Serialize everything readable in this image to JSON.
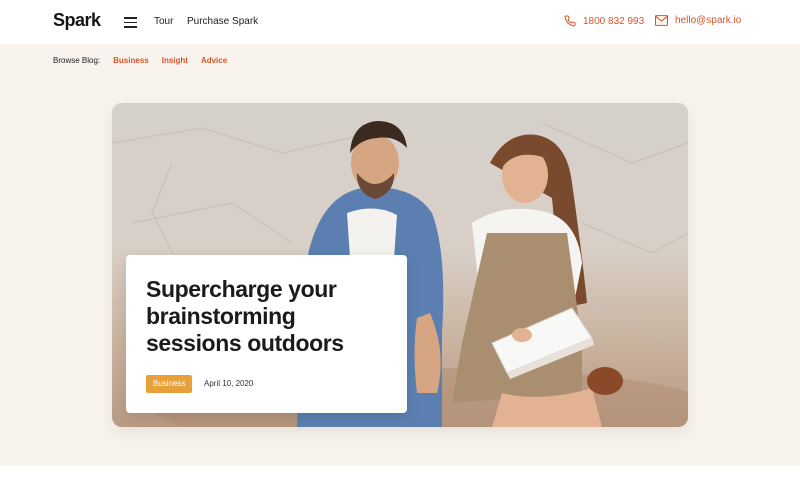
{
  "header": {
    "logo": "Spark",
    "nav": [
      {
        "label": "Tour"
      },
      {
        "label": "Purchase Spark"
      }
    ],
    "phone": "1800 832 993",
    "email": "hello@spark.io",
    "menu_icon": "hamburger-menu-icon",
    "phone_icon": "phone-icon",
    "email_icon": "mail-icon"
  },
  "browse": {
    "label": "Browse Blog:",
    "links": [
      "Business",
      "Insight",
      "Advice"
    ]
  },
  "hero": {
    "title": "Supercharge your brainstorming sessions outdoors",
    "tag": "Business",
    "date": "April 10, 2020"
  },
  "colors": {
    "accent": "#d9542b",
    "tag": "#e8a039",
    "background": "#f8f3ec"
  }
}
